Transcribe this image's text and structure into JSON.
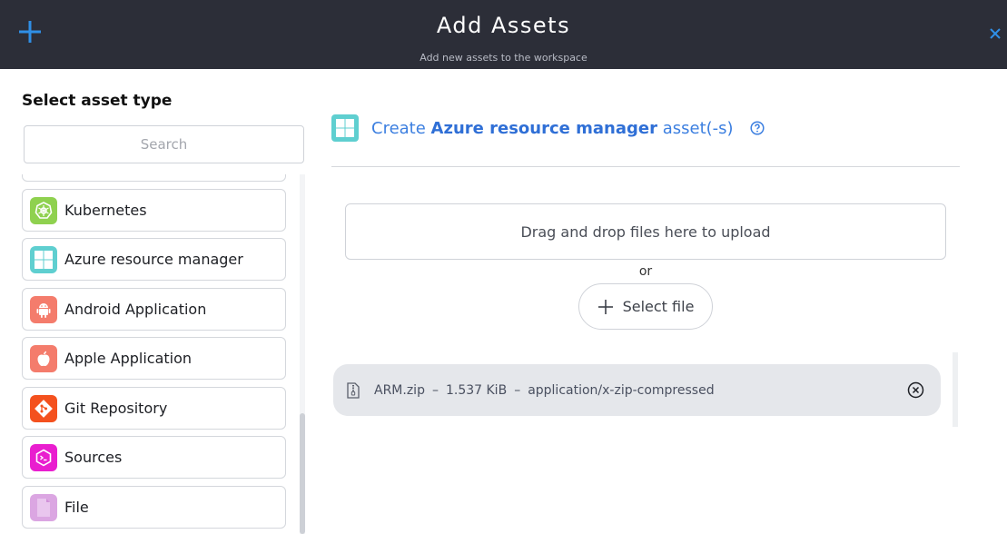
{
  "header": {
    "title": "Add Assets",
    "subtitle": "Add new assets to the workspace",
    "plus_icon": "plus-icon",
    "close_icon": "close-icon"
  },
  "left": {
    "title": "Select asset type",
    "search_placeholder": "Search",
    "items": [
      {
        "label": "Kubernetes",
        "icon": "kubernetes-icon",
        "color": "#8fd14f"
      },
      {
        "label": "Azure resource manager",
        "icon": "windows-icon",
        "color": "#5fcfd0"
      },
      {
        "label": "Android Application",
        "icon": "android-icon",
        "color": "#f47c6c"
      },
      {
        "label": "Apple Application",
        "icon": "apple-icon",
        "color": "#f47c6c"
      },
      {
        "label": "Git Repository",
        "icon": "git-icon",
        "color": "#f4511e"
      },
      {
        "label": "Sources",
        "icon": "terminal-icon",
        "color": "#e91ecf"
      },
      {
        "label": "File",
        "icon": "file-icon",
        "color": "#dba6e2"
      }
    ]
  },
  "main": {
    "create_prefix": "Create",
    "create_type": "Azure resource manager",
    "create_suffix": "asset(-s)",
    "dropzone_label": "Drag and drop files here to upload",
    "or_label": "or",
    "select_file_label": "Select file",
    "file": {
      "name": "ARM.zip",
      "size": "1.537 KiB",
      "mime": "application/x-zip-compressed",
      "sep": "–"
    }
  },
  "colors": {
    "header_bg": "#2c2e38",
    "accent_blue": "#3c7fe0",
    "plus_blue": "#2f8fe6"
  }
}
